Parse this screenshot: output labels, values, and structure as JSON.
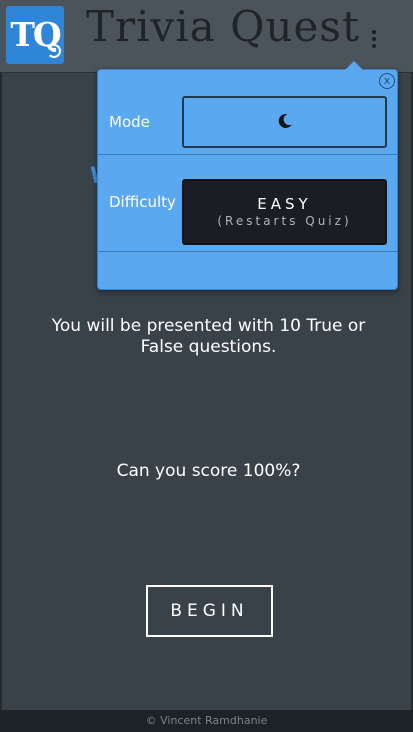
{
  "header": {
    "logo_text": "TQ",
    "title": "Trivia Quest",
    "menu_icon": "more-vertical-icon"
  },
  "main": {
    "welcome_peek": "W",
    "intro": "You will be presented with 10 True or False questions.",
    "score_prompt": "Can you score 100%?",
    "begin_label": "BEGIN"
  },
  "settings": {
    "close_label": "x",
    "mode_label": "Mode",
    "mode_icon": "moon-icon",
    "difficulty_label": "Difficulty",
    "difficulty_value": "EASY",
    "difficulty_note": "(Restarts Quiz)"
  },
  "footer": {
    "text": "© Vincent Ramdhanie"
  },
  "colors": {
    "background": "#3a4249",
    "header": "#4b535b",
    "accent": "#5aa9f0",
    "logo": "#2f86d8",
    "dark_button": "#1a1e22"
  }
}
